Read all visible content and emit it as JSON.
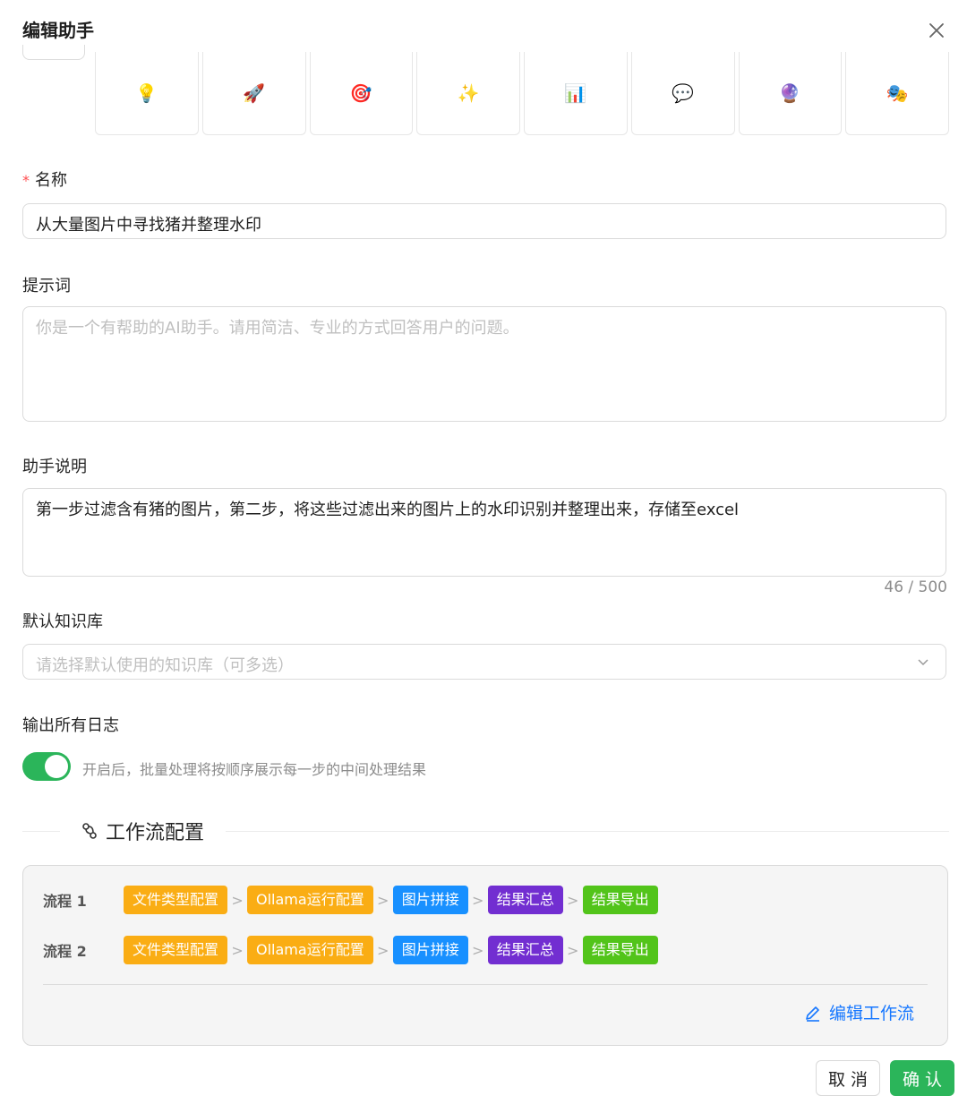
{
  "dialog": {
    "title": "编辑助手",
    "icons": [
      {
        "name": "lightbulb-icon",
        "glyph": "💡"
      },
      {
        "name": "rocket-icon",
        "glyph": "🚀"
      },
      {
        "name": "target-icon",
        "glyph": "🎯"
      },
      {
        "name": "sparkles-icon",
        "glyph": "✨"
      },
      {
        "name": "bar-chart-icon",
        "glyph": "📊"
      },
      {
        "name": "speech-bubble-icon",
        "glyph": "💬"
      },
      {
        "name": "crystal-ball-icon",
        "glyph": "🔮"
      },
      {
        "name": "theater-masks-icon",
        "glyph": "🎭"
      }
    ]
  },
  "form": {
    "name": {
      "required_mark": "*",
      "label": "名称",
      "value": "从大量图片中寻找猪并整理水印"
    },
    "prompt": {
      "label": "提示词",
      "placeholder": "你是一个有帮助的AI助手。请用简洁、专业的方式回答用户的问题。",
      "value": ""
    },
    "description": {
      "label": "助手说明",
      "value": "第一步过滤含有猪的图片，第二步，将这些过滤出来的图片上的水印识别并整理出来，存储至excel",
      "count": "46 / 500"
    },
    "knowledge": {
      "label": "默认知识库",
      "placeholder": "请选择默认使用的知识库（可多选）"
    },
    "log": {
      "label": "输出所有日志",
      "toggle_on": true,
      "hint": "开启后，批量处理将按顺序展示每一步的中间处理结果"
    }
  },
  "workflow": {
    "title": "工作流配置",
    "flows": [
      {
        "name": "流程 1",
        "steps": [
          "文件类型配置",
          "Ollama运行配置",
          "图片拼接",
          "结果汇总",
          "结果导出"
        ]
      },
      {
        "name": "流程 2",
        "steps": [
          "文件类型配置",
          "Ollama运行配置",
          "图片拼接",
          "结果汇总",
          "结果导出"
        ]
      }
    ],
    "step_colors": [
      "#faad14",
      "#faad14",
      "#1890ff",
      "#722ed1",
      "#52c41a"
    ],
    "separator": ">",
    "edit_label": "编辑工作流"
  },
  "footer": {
    "cancel_label": "取 消",
    "ok_label": "确 认"
  },
  "colors": {
    "accent_green": "#2bb55a",
    "link_blue": "#1677ff",
    "required_red": "#ff4d4f"
  }
}
